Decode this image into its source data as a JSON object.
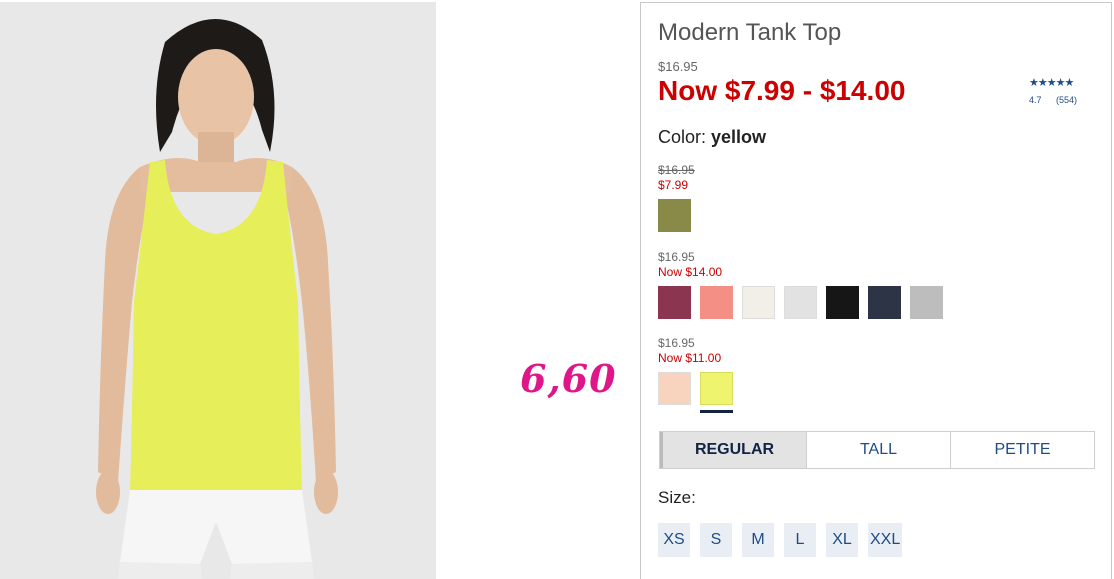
{
  "product": {
    "title": "Modern Tank Top",
    "original_price": "$16.95",
    "sale_price": "Now $7.99 - $14.00",
    "rating": {
      "stars": "★★★★★",
      "score": "4.7",
      "count": "(554)"
    },
    "color_label": "Color:",
    "color_value": "yellow"
  },
  "price_groups": [
    {
      "was": "$16.95",
      "now": "$7.99",
      "swatches": [
        "#8a8a48"
      ]
    },
    {
      "was": "$16.95",
      "now": "Now $14.00",
      "swatches": [
        "#8b3550",
        "#f48f86",
        "#f1efe8",
        "#e2e2e2",
        "#161616",
        "#2d3446",
        "#bdbdbd"
      ]
    },
    {
      "was": "$16.95",
      "now": "Now $11.00",
      "swatches": [
        "#f8d3bd",
        "#eef46d"
      ]
    }
  ],
  "annotation": "6,60",
  "fit_tabs": [
    {
      "label": "REGULAR",
      "active": true
    },
    {
      "label": "TALL",
      "active": false
    },
    {
      "label": "PETITE",
      "active": false
    }
  ],
  "size_label": "Size:",
  "sizes": [
    "XS",
    "S",
    "M",
    "L",
    "XL",
    "XXL"
  ],
  "colors": {
    "sale_red": "#cc0000",
    "link_blue": "#1f4b86",
    "annotation_pink": "#e0158a"
  }
}
